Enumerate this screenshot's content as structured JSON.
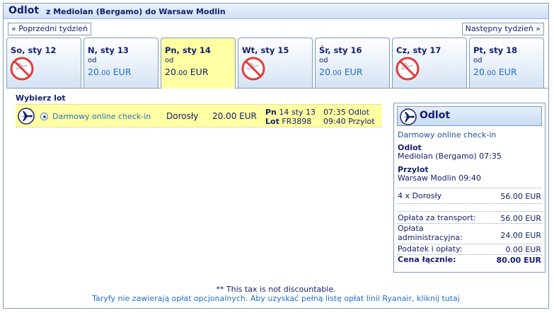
{
  "header": {
    "title": "Odlot",
    "route": "z Mediolan (Bergamo) do Warsaw Modlin"
  },
  "nav": {
    "prev_label": "« Poprzedni tydzień",
    "next_label": "Następny tydzień »"
  },
  "days": [
    {
      "label": "So, sty 12",
      "od": "",
      "price_int": "",
      "price_dec": "",
      "currency": "",
      "available": false
    },
    {
      "label": "N, sty 13",
      "od": "od",
      "price_int": "20",
      "price_dec": ".00",
      "currency": " EUR",
      "available": true
    },
    {
      "label": "Pn, sty 14",
      "od": "od",
      "price_int": "20",
      "price_dec": ".00",
      "currency": " EUR",
      "available": true
    },
    {
      "label": "Wt, sty 15",
      "od": "",
      "price_int": "",
      "price_dec": "",
      "currency": "",
      "available": false
    },
    {
      "label": "Śr, sty 16",
      "od": "od",
      "price_int": "20",
      "price_dec": ".00",
      "currency": " EUR",
      "available": true
    },
    {
      "label": "Cz, sty 17",
      "od": "",
      "price_int": "",
      "price_dec": "",
      "currency": "",
      "available": false
    },
    {
      "label": "Pt, sty 18",
      "od": "od",
      "price_int": "20",
      "price_dec": ".00",
      "currency": " EUR",
      "available": true
    }
  ],
  "selected_day_index": 2,
  "flight": {
    "section_label": "Wybierz lot",
    "fare_name": "Darmowy online check-in",
    "passenger_type": "Dorosły",
    "price": "20.00 EUR",
    "day_abbr": "Pn",
    "date": "14 sty 13",
    "flight_label": "Lot",
    "flight_no": "FR3898",
    "dep_time": "07:35",
    "dep_word": "Odlot",
    "arr_time": "09:40",
    "arr_word": "Przylot"
  },
  "summary": {
    "title": "Odlot",
    "fare_name": "Darmowy online check-in",
    "dep_heading": "Odlot",
    "dep_detail": "Mediolan (Bergamo) 07:35",
    "arr_heading": "Przylot",
    "arr_detail": "Warsaw Modlin 09:40",
    "pax_label": "4 x Dorosły",
    "pax_value": "56.00 EUR",
    "transport_label": "Opłata za transport:",
    "transport_value": "56.00 EUR",
    "admin_label_1": "Opłata",
    "admin_label_2": "administracyjna:",
    "admin_value": "24.00 EUR",
    "tax_label": "Podatek i opłaty:",
    "tax_value": "0.00 EUR",
    "total_label": "Cena łącznie:",
    "total_value": "80.00 EUR"
  },
  "footer": {
    "note": "** This tax is not discountable.",
    "link": "Taryfy nie zawierają opłat opcjonalnych. Aby uzyskać pełną listę opłat linii Ryanair, kliknij tutaj"
  },
  "colors": {
    "navy": "#16206a",
    "link_blue": "#1f6fc7",
    "selected_yellow": "#ffffa3",
    "no_flight_red": "#e03c3c"
  },
  "icons": {
    "no_flight": "no-flight-icon",
    "plane": "airplane-icon"
  }
}
